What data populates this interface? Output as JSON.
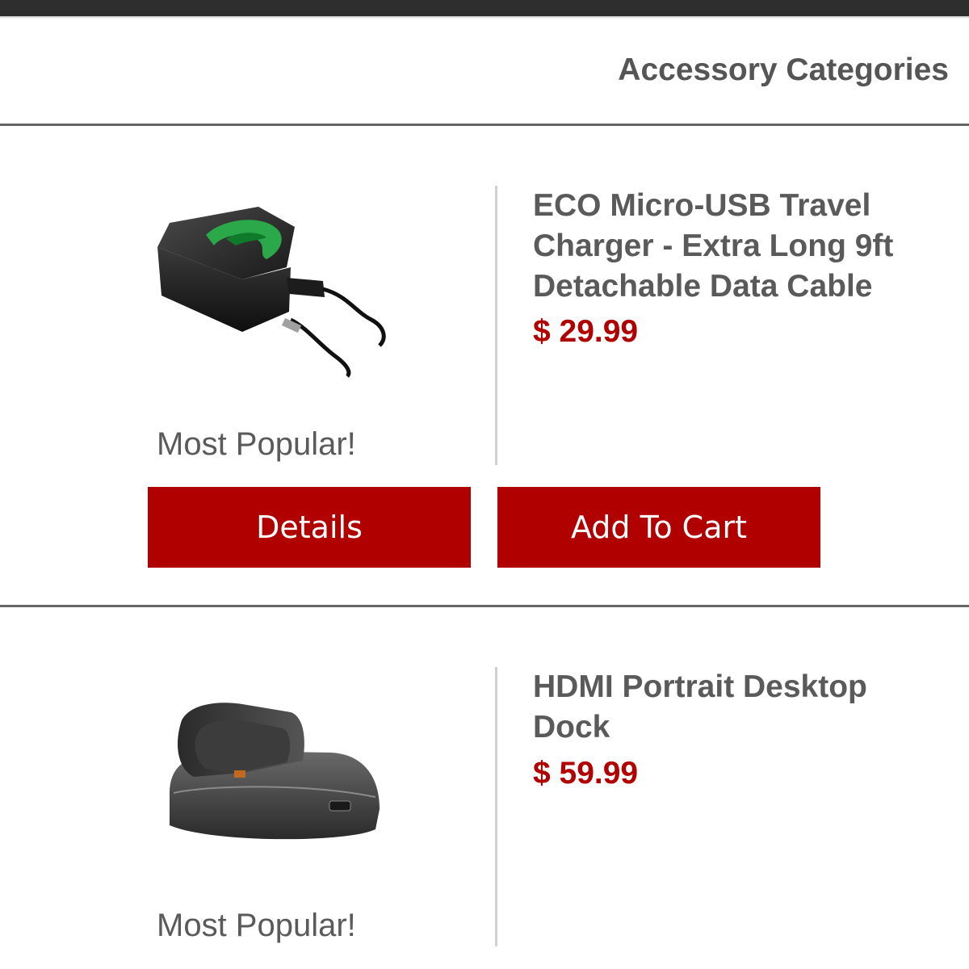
{
  "header": {
    "title": "Accessory Categories"
  },
  "products": [
    {
      "image_icon": "wall-charger-icon",
      "name": "ECO Micro-USB Travel Charger - Extra Long 9ft Detachable Data Cable",
      "price": "$ 29.99",
      "badge": "Most Popular!",
      "details_label": "Details",
      "cart_label": "Add To Cart"
    },
    {
      "image_icon": "desktop-dock-icon",
      "name": "HDMI Portrait Desktop Dock",
      "price": "$ 59.99",
      "badge": "Most Popular!"
    }
  ],
  "colors": {
    "accent": "#b10000",
    "text": "#5a5a5a",
    "top_bar": "#2e2e2e"
  }
}
